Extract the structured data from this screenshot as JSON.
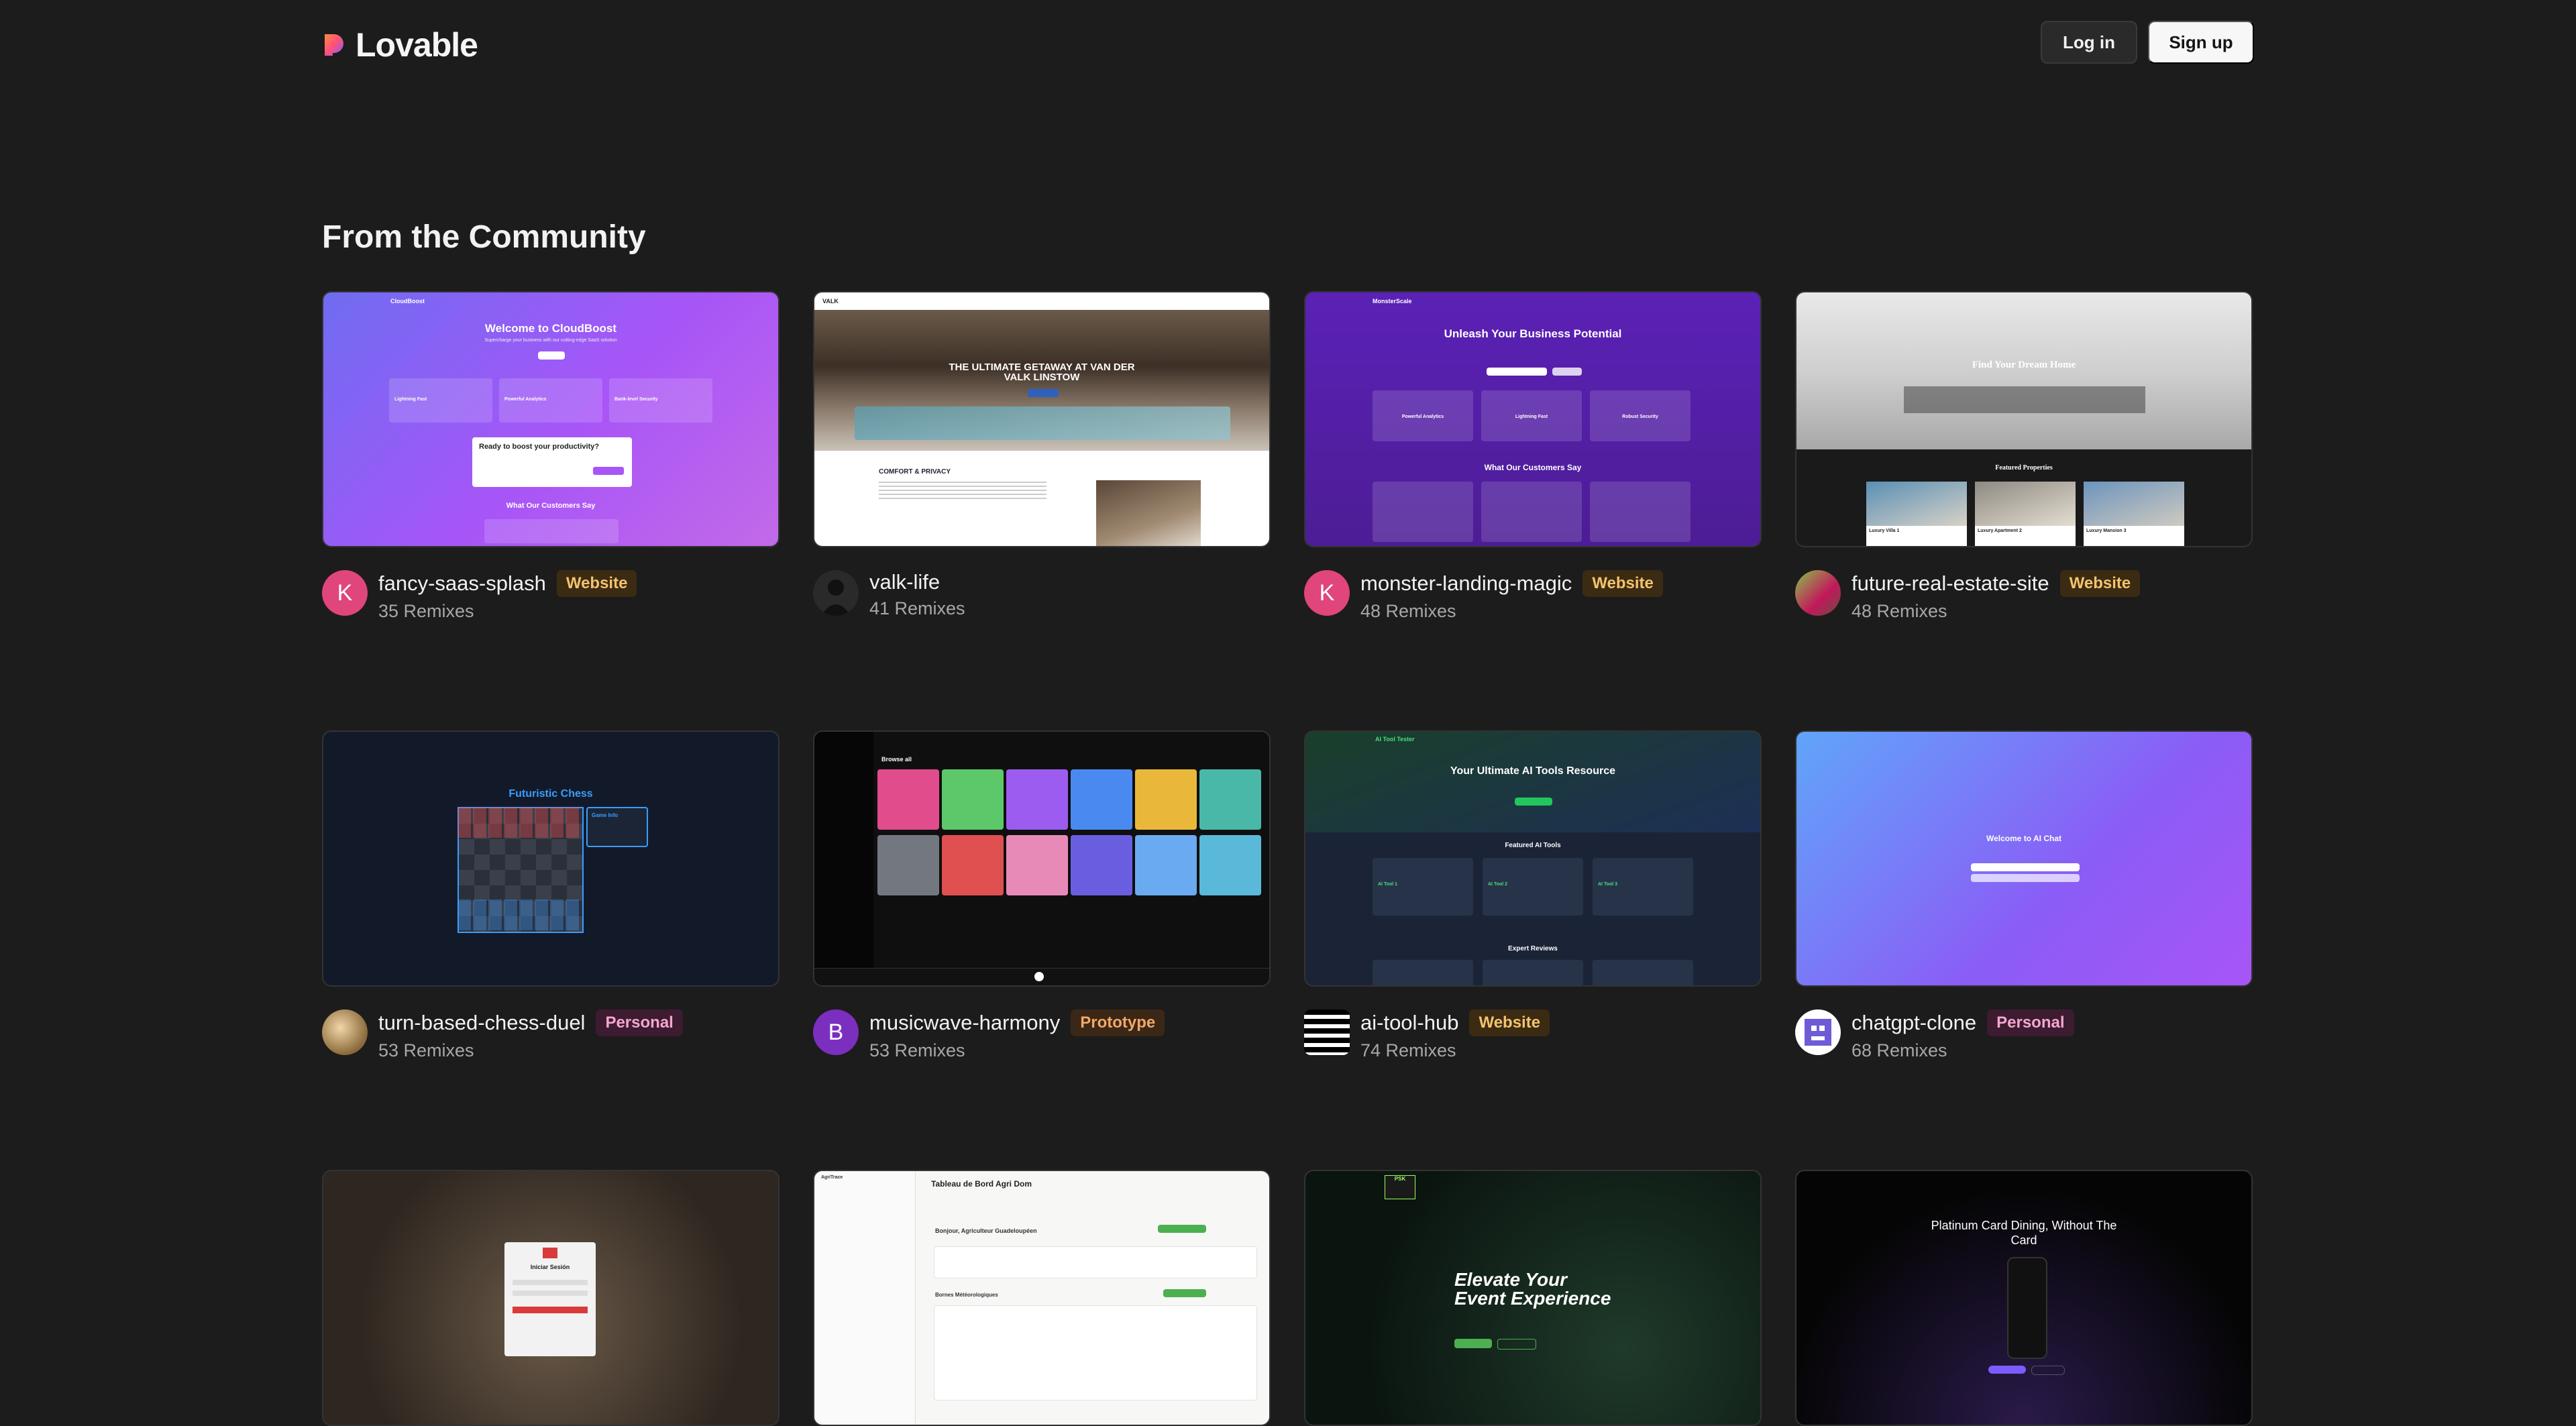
{
  "app": {
    "logo_text": "Lovable"
  },
  "header": {
    "login_label": "Log in",
    "signup_label": "Sign up"
  },
  "section": {
    "title": "From the Community"
  },
  "projects": [
    {
      "name": "fancy-saas-splash",
      "badge": "Website",
      "remixes": "35 Remixes",
      "avatar_letter": "K",
      "thumb": {
        "brand": "CloudBoost",
        "heading": "Welcome to CloudBoost",
        "sub": "Supercharge your business with our cutting-edge SaaS solution",
        "f1": "Lightning Fast",
        "f2": "Powerful Analytics",
        "f3": "Bank-level Security",
        "cta": "Ready to boost your productivity?",
        "testi": "What Our Customers Say"
      }
    },
    {
      "name": "valk-life",
      "badge": "",
      "remixes": "41 Remixes",
      "thumb": {
        "brand": "VALK",
        "hero": "THE ULTIMATE GETAWAY AT VAN DER VALK LINSTOW",
        "section": "COMFORT & PRIVACY"
      }
    },
    {
      "name": "monster-landing-magic",
      "badge": "Website",
      "remixes": "48 Remixes",
      "avatar_letter": "K",
      "thumb": {
        "brand": "MonsterScale",
        "heading": "Unleash Your Business Potential",
        "f1": "Powerful Analytics",
        "f2": "Lightning Fast",
        "f3": "Robust Security",
        "testi": "What Our Customers Say"
      }
    },
    {
      "name": "future-real-estate-site",
      "badge": "Website",
      "remixes": "48 Remixes",
      "thumb": {
        "heading": "Find Your Dream Home",
        "featured": "Featured Properties",
        "p1": "Luxury Villa 1",
        "p2": "Luxury Apartment 2",
        "p3": "Luxury Mansion 3"
      }
    },
    {
      "name": "turn-based-chess-duel",
      "badge": "Personal",
      "remixes": "53 Remixes",
      "thumb": {
        "heading": "Futuristic Chess",
        "panel": "Game Info"
      }
    },
    {
      "name": "musicwave-harmony",
      "badge": "Prototype",
      "remixes": "53 Remixes",
      "avatar_letter": "B",
      "thumb": {
        "heading": "Browse all"
      }
    },
    {
      "name": "ai-tool-hub",
      "badge": "Website",
      "remixes": "74 Remixes",
      "thumb": {
        "brand": "AI Tool Tester",
        "heading": "Your Ultimate AI Tools Resource",
        "featured": "Featured AI Tools",
        "tool1": "AI Tool 1",
        "tool2": "AI Tool 2",
        "tool3": "AI Tool 3",
        "reviews": "Expert Reviews"
      }
    },
    {
      "name": "chatgpt-clone",
      "badge": "Personal",
      "remixes": "68 Remixes",
      "thumb": {
        "heading": "Welcome to AI Chat"
      }
    },
    {
      "name": "",
      "badge": "",
      "remixes": "",
      "thumb": {
        "heading": "Iniciar Sesión"
      }
    },
    {
      "name": "",
      "badge": "",
      "remixes": "",
      "thumb": {
        "brand": "AgriTrace",
        "heading": "Tableau de Bord Agri Dom",
        "greeting": "Bonjour, Agriculteur Guadeloupéen",
        "section": "Bornes Météorologiques"
      }
    },
    {
      "name": "",
      "badge": "",
      "remixes": "",
      "thumb": {
        "brand": "PSK",
        "heading": "Elevate Your Event Experience"
      }
    },
    {
      "name": "",
      "badge": "",
      "remixes": "",
      "thumb": {
        "heading": "Platinum Card Dining, Without The Card"
      }
    }
  ],
  "colors": {
    "background": "#1c1c1c",
    "website_badge": "#f3c36d",
    "personal_badge": "#f4a6cf",
    "prototype_badge": "#f0a868"
  }
}
